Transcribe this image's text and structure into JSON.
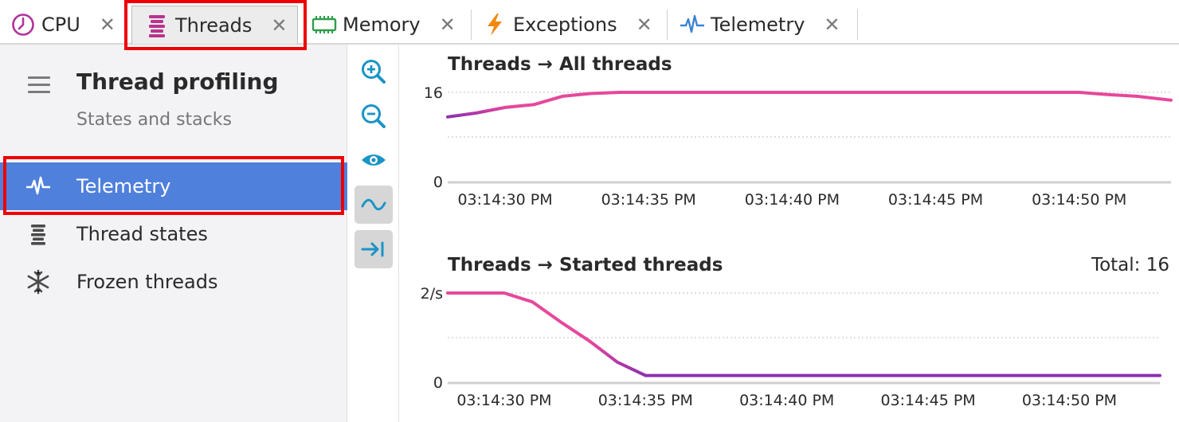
{
  "tabs": [
    {
      "label": "CPU",
      "icon": "clock-icon",
      "close": "✕"
    },
    {
      "label": "Threads",
      "icon": "threads-stack-icon",
      "close": "✕",
      "active": true
    },
    {
      "label": "Memory",
      "icon": "memory-chip-icon",
      "close": "✕"
    },
    {
      "label": "Exceptions",
      "icon": "lightning-icon",
      "close": "✕"
    },
    {
      "label": "Telemetry",
      "icon": "pulse-icon",
      "close": "✕"
    }
  ],
  "sidebar": {
    "title": "Thread profiling",
    "subtitle": "States and stacks",
    "items": [
      {
        "label": "Telemetry",
        "icon": "pulse-icon",
        "selected": true
      },
      {
        "label": "Thread states",
        "icon": "threads-stack-icon"
      },
      {
        "label": "Frozen threads",
        "icon": "snowflake-icon"
      }
    ]
  },
  "toolbar": {
    "tools": [
      {
        "name": "zoom-in-icon"
      },
      {
        "name": "zoom-out-icon"
      },
      {
        "name": "eye-icon"
      },
      {
        "name": "smooth-wave-icon",
        "pressed": true
      },
      {
        "name": "scroll-to-end-icon",
        "pressed": true
      }
    ]
  },
  "colors": {
    "accent": "#4f80db",
    "line_pink": "#e6489b",
    "line_purple": "#8e2fb0",
    "icon_blue": "#1a94c6",
    "highlight": "#ee0000"
  },
  "chart_data": [
    {
      "type": "line",
      "title": "Threads → All threads",
      "yticks": [
        "16",
        "0"
      ],
      "ylim": [
        0,
        16
      ],
      "xticks": [
        "03:14:30 PM",
        "03:14:35 PM",
        "03:14:40 PM",
        "03:14:45 PM",
        "03:14:50 PM"
      ],
      "xlim": [
        28,
        53.2
      ],
      "grid": true,
      "series": [
        {
          "x": [
            28,
            29,
            30,
            31,
            32,
            33,
            34,
            35,
            36,
            37,
            38,
            39,
            40,
            41,
            42,
            43,
            44,
            45,
            46,
            47,
            48,
            49,
            50,
            51,
            52,
            53.2
          ],
          "values": [
            11.6,
            12.3,
            13.3,
            13.8,
            15.3,
            15.8,
            16,
            16,
            16,
            16,
            16,
            16,
            16,
            16,
            16,
            16,
            16,
            16,
            16,
            16,
            16,
            16,
            16,
            15.6,
            15.3,
            14.6
          ]
        }
      ]
    },
    {
      "type": "line",
      "title": "Threads → Started threads",
      "total": "Total: 16",
      "yticks": [
        "2/s",
        "0"
      ],
      "ylim": [
        0,
        2
      ],
      "xticks": [
        "03:14:30 PM",
        "03:14:35 PM",
        "03:14:40 PM",
        "03:14:45 PM",
        "03:14:50 PM"
      ],
      "xlim": [
        28,
        53.2
      ],
      "grid": true,
      "series": [
        {
          "x": [
            28,
            30,
            31,
            32,
            33,
            34,
            35,
            36,
            40,
            45,
            50,
            53.2
          ],
          "values": [
            2,
            2,
            1.8,
            1.35,
            0.93,
            0.45,
            0.15,
            0.15,
            0.15,
            0.15,
            0.15,
            0.15
          ]
        }
      ]
    }
  ]
}
